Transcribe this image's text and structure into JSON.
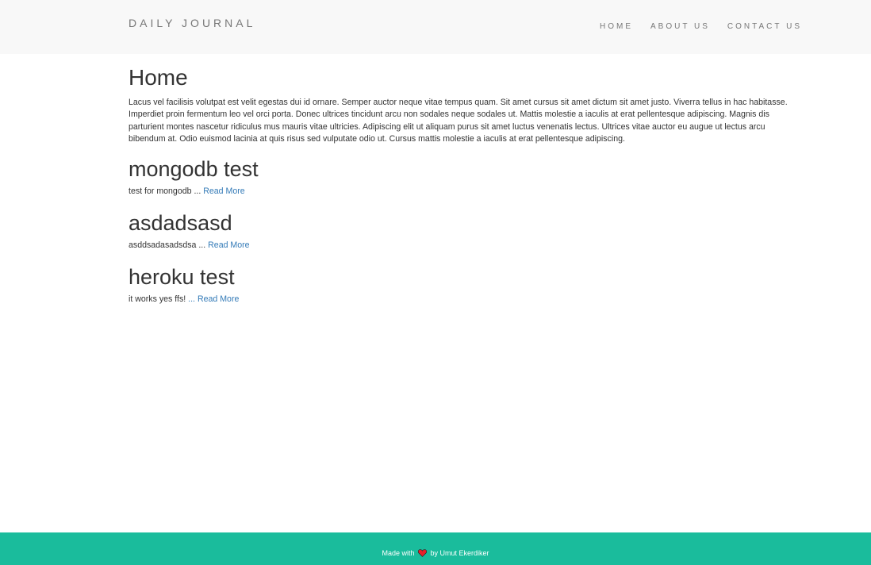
{
  "navbar": {
    "brand": "DAILY JOURNAL",
    "links": [
      "HOME",
      "ABOUT US",
      "CONTACT US"
    ]
  },
  "main": {
    "title": "Home",
    "intro": "Lacus vel facilisis volutpat est velit egestas dui id ornare. Semper auctor neque vitae tempus quam. Sit amet cursus sit amet dictum sit amet justo. Viverra tellus in hac habitasse. Imperdiet proin fermentum leo vel orci porta. Donec ultrices tincidunt arcu non sodales neque sodales ut. Mattis molestie a iaculis at erat pellentesque adipiscing. Magnis dis parturient montes nascetur ridiculus mus mauris vitae ultricies. Adipiscing elit ut aliquam purus sit amet luctus venenatis lectus. Ultrices vitae auctor eu augue ut lectus arcu bibendum at. Odio euismod lacinia at quis risus sed vulputate odio ut. Cursus mattis molestie a iaculis at erat pellentesque adipiscing.",
    "posts": [
      {
        "title": "mongodb test",
        "excerpt": "test for mongodb",
        "ellipsis": "...",
        "read_more": "Read More"
      },
      {
        "title": "asdadsasd",
        "excerpt": "asddsadasadsdsa",
        "ellipsis": "...",
        "read_more": "Read More"
      },
      {
        "title": "heroku test",
        "excerpt": "it works yes ffs!",
        "ellipsis": "...",
        "read_more": "Read More"
      }
    ]
  },
  "footer": {
    "prefix": "Made with",
    "icon": "heart-icon",
    "suffix": "by Umut Ekerdiker"
  },
  "colors": {
    "navbar_bg": "#f8f8f8",
    "footer_bg": "#1abc9c",
    "link": "#337ab7",
    "heart": "#e8212a"
  }
}
